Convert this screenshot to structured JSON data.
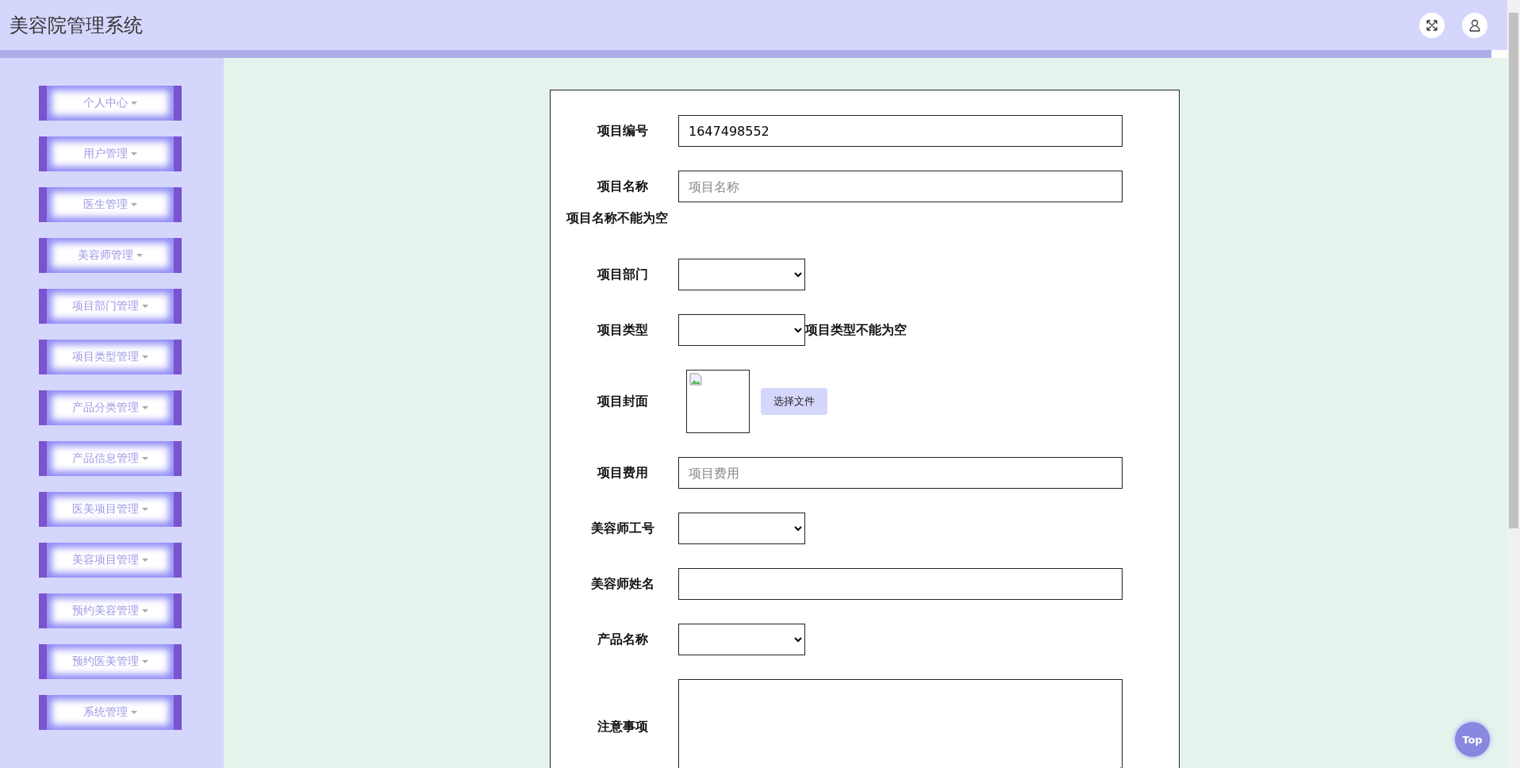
{
  "header": {
    "title": "美容院管理系统"
  },
  "sidebar": {
    "items": [
      {
        "label": "个人中心"
      },
      {
        "label": "用户管理"
      },
      {
        "label": "医生管理"
      },
      {
        "label": "美容师管理"
      },
      {
        "label": "项目部门管理"
      },
      {
        "label": "项目类型管理"
      },
      {
        "label": "产品分类管理"
      },
      {
        "label": "产品信息管理"
      },
      {
        "label": "医美项目管理"
      },
      {
        "label": "美容项目管理"
      },
      {
        "label": "预约美容管理"
      },
      {
        "label": "预约医美管理"
      },
      {
        "label": "系统管理"
      }
    ]
  },
  "form": {
    "fields": [
      {
        "kind": "text",
        "label": "项目编号",
        "value": "1647498552"
      },
      {
        "kind": "text",
        "label": "项目名称",
        "placeholder": "项目名称",
        "error": "项目名称不能为空"
      },
      {
        "kind": "select",
        "label": "项目部门"
      },
      {
        "kind": "select",
        "label": "项目类型",
        "error": "项目类型不能为空"
      },
      {
        "kind": "image",
        "label": "项目封面",
        "button": "选择文件"
      },
      {
        "kind": "text",
        "label": "项目费用",
        "placeholder": "项目费用"
      },
      {
        "kind": "select",
        "label": "美容师工号"
      },
      {
        "kind": "text",
        "label": "美容师姓名"
      },
      {
        "kind": "select",
        "label": "产品名称"
      },
      {
        "kind": "textarea",
        "label": "注意事项"
      }
    ]
  },
  "back_to_top": "Top"
}
